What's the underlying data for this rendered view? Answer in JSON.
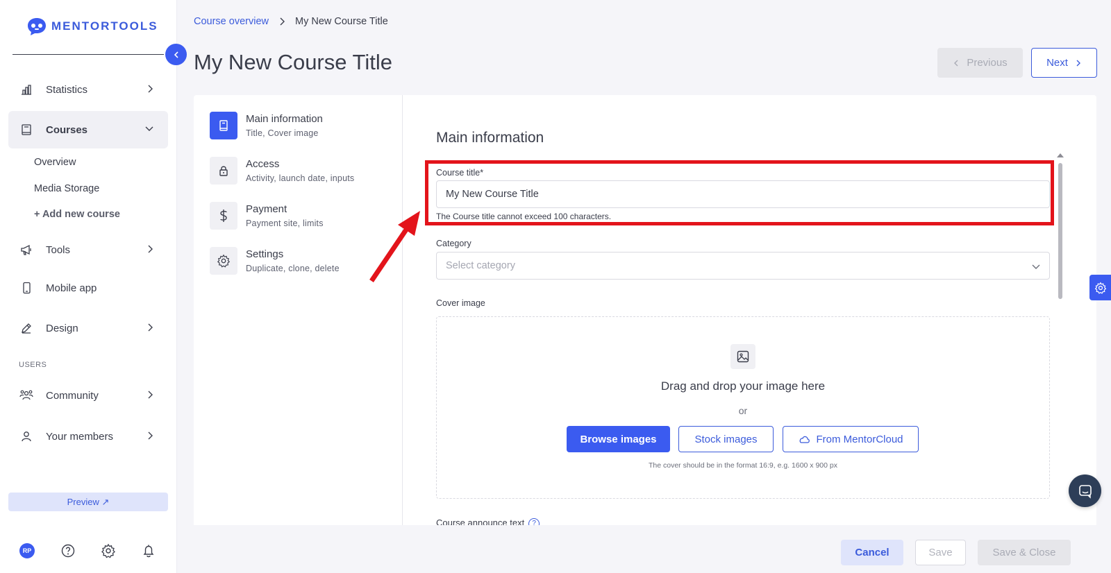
{
  "brand": {
    "name": "MENTORTOOLS"
  },
  "sidebar": {
    "items": [
      {
        "label": "Statistics",
        "icon": "bar-chart-icon"
      },
      {
        "label": "Courses",
        "icon": "book-icon"
      },
      {
        "label": "Tools",
        "icon": "megaphone-icon"
      },
      {
        "label": "Mobile app",
        "icon": "mobile-icon"
      },
      {
        "label": "Design",
        "icon": "pencil-icon"
      },
      {
        "label": "Community",
        "icon": "community-icon"
      },
      {
        "label": "Your members",
        "icon": "user-icon"
      }
    ],
    "sub_items": [
      "Overview",
      "Media Storage",
      "+ Add new course"
    ],
    "section_users": "USERS",
    "preview_label": "Preview ↗",
    "avatar_initials": "RP"
  },
  "breadcrumb": {
    "parent": "Course overview",
    "current": "My New Course Title"
  },
  "page_title": "My New Course Title",
  "nav_buttons": {
    "previous": "Previous",
    "next": "Next"
  },
  "steps": [
    {
      "title": "Main information",
      "subtitle": "Title, Cover image"
    },
    {
      "title": "Access",
      "subtitle": "Activity, launch date, inputs"
    },
    {
      "title": "Payment",
      "subtitle": "Payment site, limits"
    },
    {
      "title": "Settings",
      "subtitle": "Duplicate, clone, delete"
    }
  ],
  "form": {
    "section_title": "Main information",
    "course_title_label": "Course title*",
    "course_title_value": "My New Course Title",
    "course_title_hint": "The Course title cannot exceed 100 characters.",
    "category_label": "Category",
    "category_placeholder": "Select category",
    "cover_label": "Cover image",
    "dropzone_title": "Drag and drop your image here",
    "dropzone_or": "or",
    "browse_label": "Browse images",
    "stock_label": "Stock images",
    "cloud_label": "From MentorCloud",
    "cover_note": "The cover should be in the format 16:9, e.g. 1600 x 900 px",
    "announce_label": "Course announce text"
  },
  "footer": {
    "cancel": "Cancel",
    "save": "Save",
    "save_close": "Save & Close"
  },
  "colors": {
    "accent": "#3b5bf0",
    "highlight": "#e3141b",
    "chat": "#2d3e58"
  }
}
